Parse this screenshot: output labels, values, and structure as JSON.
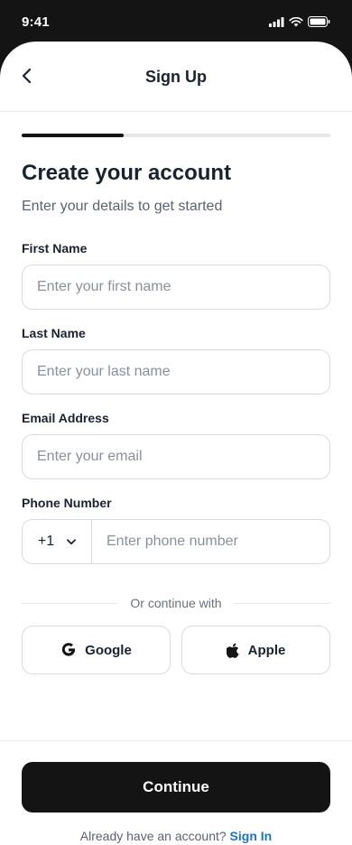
{
  "status_bar": {
    "time": "9:41"
  },
  "header": {
    "title": "Sign Up",
    "back_icon": "chevron-left-icon"
  },
  "progress": {
    "step_fraction": 0.33
  },
  "intro": {
    "title": "Create your account",
    "subtitle": "Enter your details to get started"
  },
  "form": {
    "first_name": {
      "label": "First Name",
      "placeholder": "Enter your first name",
      "value": ""
    },
    "last_name": {
      "label": "Last Name",
      "placeholder": "Enter your last name",
      "value": ""
    },
    "email": {
      "label": "Email Address",
      "placeholder": "Enter your email",
      "value": ""
    },
    "phone": {
      "label": "Phone Number",
      "country_code": "+1",
      "placeholder": "Enter phone number",
      "value": ""
    }
  },
  "social": {
    "divider_text": "Or continue with",
    "google_label": "Google",
    "apple_label": "Apple"
  },
  "footer": {
    "continue_label": "Continue",
    "signin_prompt": "Already have an account?",
    "signin_link": "Sign In"
  },
  "colors": {
    "primary": "#141414",
    "link": "#1a73c9",
    "border": "#d8dbe0"
  }
}
